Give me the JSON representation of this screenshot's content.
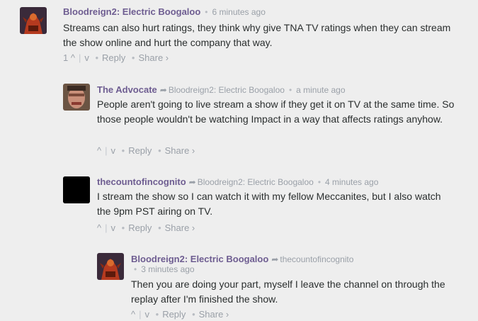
{
  "comments": [
    {
      "author": "Bloodreign2: Electric Boogaloo",
      "time": "6 minutes ago",
      "body": "Streams can also hurt ratings, they think why give TNA TV ratings when they can stream the show online and hurt the company that way.",
      "upvotes": "1",
      "reply_label": "Reply",
      "share_label": "Share ›"
    },
    {
      "author": "The Advocate",
      "reply_to": "Bloodreign2: Electric Boogaloo",
      "time": "a minute ago",
      "body": "People aren't going to live stream a show if they get it on TV at the same time. So those people wouldn't be watching Impact in a way that affects ratings anyhow.",
      "reply_label": "Reply",
      "share_label": "Share ›"
    },
    {
      "author": "thecountofincognito",
      "reply_to": "Bloodreign2: Electric Boogaloo",
      "time": "4 minutes ago",
      "body": "I stream the show so I can watch it with my fellow Meccanites, but I also watch the 9pm PST airing on TV.",
      "reply_label": "Reply",
      "share_label": "Share ›"
    },
    {
      "author": "Bloodreign2: Electric Boogaloo",
      "reply_to": "thecountofincognito",
      "time": "3 minutes ago",
      "body": "Then you are doing your part, myself I leave the channel on through the replay after I'm finished the show.",
      "reply_label": "Reply",
      "share_label": "Share ›"
    }
  ],
  "icons": {
    "upvote": "^",
    "downvote": "v",
    "reply_arrow": "➦"
  },
  "colors": {
    "background": "#eeeeee",
    "author_purple": "#6e5d91",
    "meta_gray": "#9aa0a8",
    "text": "#2a2e2e"
  }
}
